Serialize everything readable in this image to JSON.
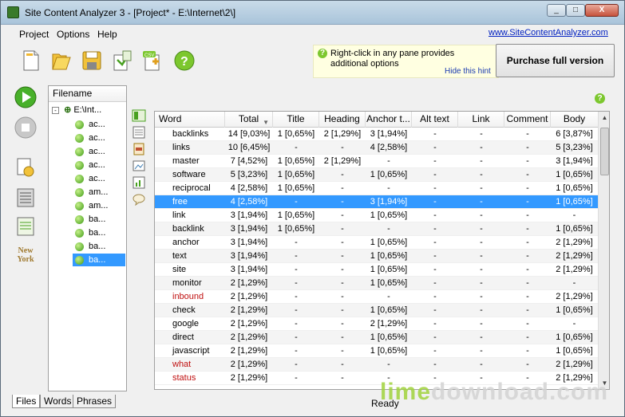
{
  "window": {
    "title": "Site Content Analyzer 3 - [Project* - E:\\Internet\\2\\]",
    "controls": [
      "_",
      "□",
      "X"
    ]
  },
  "menu": {
    "items": [
      "Project",
      "Options",
      "Help"
    ],
    "site_link": "www.SiteContentAnalyzer.com"
  },
  "toolbar": {
    "icons": [
      "new-project-icon",
      "open-folder-icon",
      "save-icon",
      "export-icon",
      "csv-icon",
      "help-icon"
    ],
    "csv_label": "CSV",
    "hint_text": "Right-click in any pane provides additional options",
    "hint_hide": "Hide this hint",
    "purchase_label": "Purchase full version"
  },
  "left_tools": {
    "icons": [
      "play-icon",
      "stop-icon",
      "settings-icon",
      "list-icon",
      "report-icon",
      "city-icon"
    ],
    "city_label": "New York"
  },
  "tree": {
    "header": "Filename",
    "root_label": "E:\\Int...",
    "items": [
      "ac...",
      "ac...",
      "ac...",
      "ac...",
      "ac...",
      "am...",
      "am...",
      "ba...",
      "ba...",
      "ba...",
      "ba..."
    ],
    "selected_index": 10
  },
  "bottom_tabs": [
    "Files",
    "Words",
    "Phrases"
  ],
  "grid": {
    "columns": [
      "Word",
      "Total",
      "Title",
      "Heading",
      "Anchor t...",
      "Alt text",
      "Link",
      "Comment",
      "Body"
    ],
    "selected_row": 5,
    "rows": [
      {
        "word": "backlinks",
        "red": false,
        "cells": [
          "14 [9,03%]",
          "1 [0,65%]",
          "2 [1,29%]",
          "3 [1,94%]",
          "-",
          "-",
          "-",
          "6 [3,87%]"
        ]
      },
      {
        "word": "links",
        "red": false,
        "cells": [
          "10 [6,45%]",
          "-",
          "-",
          "4 [2,58%]",
          "-",
          "-",
          "-",
          "5 [3,23%]"
        ]
      },
      {
        "word": "master",
        "red": false,
        "cells": [
          "7 [4,52%]",
          "1 [0,65%]",
          "2 [1,29%]",
          "-",
          "-",
          "-",
          "-",
          "3 [1,94%]"
        ]
      },
      {
        "word": "software",
        "red": false,
        "cells": [
          "5 [3,23%]",
          "1 [0,65%]",
          "-",
          "1 [0,65%]",
          "-",
          "-",
          "-",
          "1 [0,65%]"
        ]
      },
      {
        "word": "reciprocal",
        "red": false,
        "cells": [
          "4 [2,58%]",
          "1 [0,65%]",
          "-",
          "-",
          "-",
          "-",
          "-",
          "1 [0,65%]"
        ]
      },
      {
        "word": "free",
        "red": false,
        "cells": [
          "4 [2,58%]",
          "-",
          "-",
          "3 [1,94%]",
          "-",
          "-",
          "-",
          "1 [0,65%]"
        ]
      },
      {
        "word": "link",
        "red": false,
        "cells": [
          "3 [1,94%]",
          "1 [0,65%]",
          "-",
          "1 [0,65%]",
          "-",
          "-",
          "-",
          "-"
        ]
      },
      {
        "word": "backlink",
        "red": false,
        "cells": [
          "3 [1,94%]",
          "1 [0,65%]",
          "-",
          "-",
          "-",
          "-",
          "-",
          "1 [0,65%]"
        ]
      },
      {
        "word": "anchor",
        "red": false,
        "cells": [
          "3 [1,94%]",
          "-",
          "-",
          "1 [0,65%]",
          "-",
          "-",
          "-",
          "2 [1,29%]"
        ]
      },
      {
        "word": "text",
        "red": false,
        "cells": [
          "3 [1,94%]",
          "-",
          "-",
          "1 [0,65%]",
          "-",
          "-",
          "-",
          "2 [1,29%]"
        ]
      },
      {
        "word": "site",
        "red": false,
        "cells": [
          "3 [1,94%]",
          "-",
          "-",
          "1 [0,65%]",
          "-",
          "-",
          "-",
          "2 [1,29%]"
        ]
      },
      {
        "word": "monitor",
        "red": false,
        "cells": [
          "2 [1,29%]",
          "-",
          "-",
          "1 [0,65%]",
          "-",
          "-",
          "-",
          "-"
        ]
      },
      {
        "word": "inbound",
        "red": true,
        "cells": [
          "2 [1,29%]",
          "-",
          "-",
          "-",
          "-",
          "-",
          "-",
          "2 [1,29%]"
        ]
      },
      {
        "word": "check",
        "red": false,
        "cells": [
          "2 [1,29%]",
          "-",
          "-",
          "1 [0,65%]",
          "-",
          "-",
          "-",
          "1 [0,65%]"
        ]
      },
      {
        "word": "google",
        "red": false,
        "cells": [
          "2 [1,29%]",
          "-",
          "-",
          "2 [1,29%]",
          "-",
          "-",
          "-",
          "-"
        ]
      },
      {
        "word": "direct",
        "red": false,
        "cells": [
          "2 [1,29%]",
          "-",
          "-",
          "1 [0,65%]",
          "-",
          "-",
          "-",
          "1 [0,65%]"
        ]
      },
      {
        "word": "javascript",
        "red": false,
        "cells": [
          "2 [1,29%]",
          "-",
          "-",
          "1 [0,65%]",
          "-",
          "-",
          "-",
          "1 [0,65%]"
        ]
      },
      {
        "word": "what",
        "red": true,
        "cells": [
          "2 [1,29%]",
          "-",
          "-",
          "-",
          "-",
          "-",
          "-",
          "2 [1,29%]"
        ]
      },
      {
        "word": "status",
        "red": true,
        "cells": [
          "2 [1,29%]",
          "-",
          "-",
          "-",
          "-",
          "-",
          "-",
          "2 [1,29%]"
        ]
      }
    ]
  },
  "status": {
    "text": "Ready"
  },
  "watermark": {
    "part1": "lime",
    "part2": "download.com"
  },
  "colors": {
    "selection": "#3399ff",
    "red_word": "#c01010",
    "hint_bg": "#ffffe1",
    "titlebar": "#a9c4da"
  }
}
